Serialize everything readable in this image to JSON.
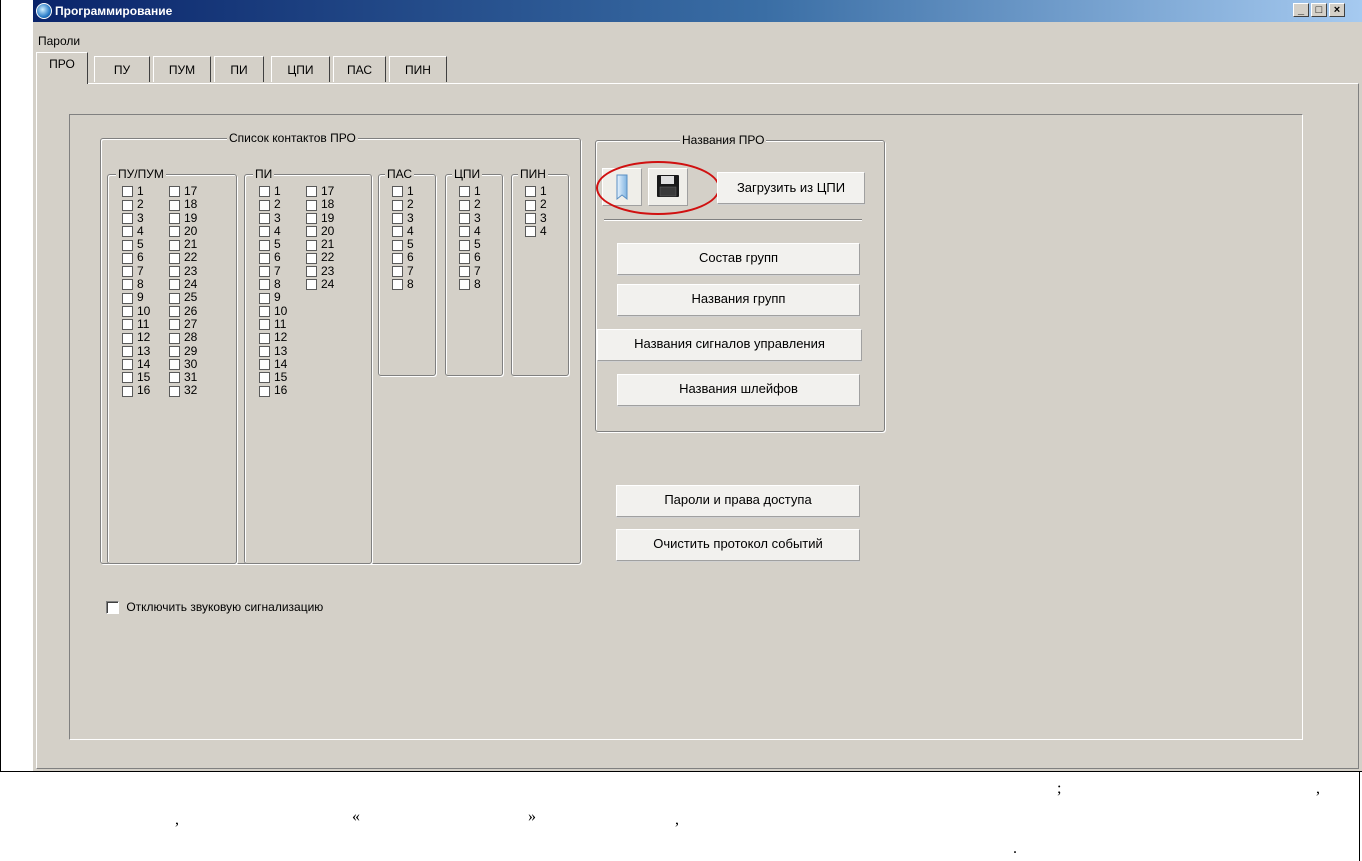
{
  "window": {
    "title": "Программирование",
    "min_label": "_",
    "max_label": "□",
    "close_label": "×"
  },
  "menu": {
    "passwords": "Пароли"
  },
  "tabs": [
    "ПРО",
    "ПУ",
    "ПУМ",
    "ПИ",
    "ЦПИ",
    "ПАС",
    "ПИН"
  ],
  "contacts": {
    "title": "Список контактов ПРО",
    "groups": [
      {
        "label": "ПУ/ПУМ",
        "cols": [
          [
            "1",
            "2",
            "3",
            "4",
            "5",
            "6",
            "7",
            "8",
            "9",
            "10",
            "11",
            "12",
            "13",
            "14",
            "15",
            "16"
          ],
          [
            "17",
            "18",
            "19",
            "20",
            "21",
            "22",
            "23",
            "24",
            "25",
            "26",
            "27",
            "28",
            "29",
            "30",
            "31",
            "32"
          ]
        ]
      },
      {
        "label": "ПИ",
        "cols": [
          [
            "1",
            "2",
            "3",
            "4",
            "5",
            "6",
            "7",
            "8",
            "9",
            "10",
            "11",
            "12",
            "13",
            "14",
            "15",
            "16"
          ],
          [
            "17",
            "18",
            "19",
            "20",
            "21",
            "22",
            "23",
            "24"
          ]
        ]
      },
      {
        "label": "ПАС",
        "cols": [
          [
            "1",
            "2",
            "3",
            "4",
            "5",
            "6",
            "7",
            "8"
          ]
        ]
      },
      {
        "label": "ЦПИ",
        "cols": [
          [
            "1",
            "2",
            "3",
            "4",
            "5",
            "6",
            "7",
            "8"
          ]
        ]
      },
      {
        "label": "ПИН",
        "cols": [
          [
            "1",
            "2",
            "3",
            "4"
          ]
        ]
      }
    ]
  },
  "names": {
    "title": "Названия ПРО",
    "load_button": "Загрузить из ЦПИ",
    "buttons": [
      "Состав групп",
      "Названия групп",
      "Названия сигналов управления",
      "Названия шлейфов"
    ]
  },
  "bottom_buttons": [
    "Пароли и права доступа",
    "Очистить протокол событий"
  ],
  "mute_sound": {
    "label": "Отключить звуковую сигнализацию",
    "checked": false
  },
  "caption_punct": [
    ";",
    ",",
    ",",
    "«",
    "»",
    ",",
    "."
  ],
  "colors": {
    "window_bg": "#d4d0c8",
    "title_start": "#0a246a",
    "title_end": "#a6caf0",
    "highlight": "#d01010"
  }
}
